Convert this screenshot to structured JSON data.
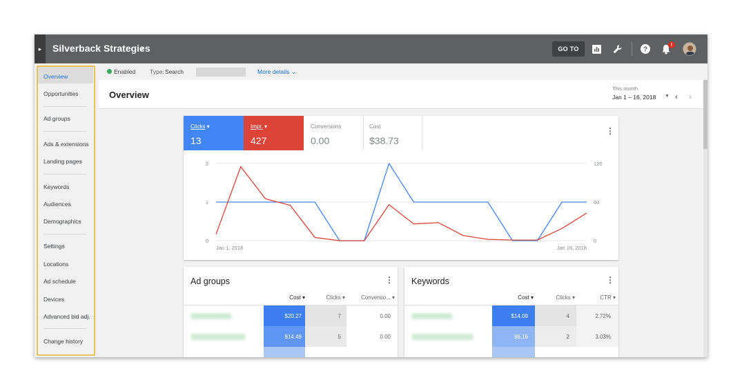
{
  "topbar": {
    "account_name": "Silverback Strategies",
    "chevron": "›",
    "drawer_icon": "▸",
    "goto_label": "GO TO",
    "icons": [
      "reports-icon",
      "tools-icon",
      "help-icon",
      "notifications-icon",
      "avatar"
    ],
    "notification_badge": "!"
  },
  "sidebar": {
    "items": [
      {
        "label": "Overview"
      },
      {
        "label": "Opportunities"
      },
      {
        "label": "Ad groups"
      },
      {
        "label": "Ads & extensions"
      },
      {
        "label": "Landing pages"
      },
      {
        "label": "Keywords"
      },
      {
        "label": "Audiences"
      },
      {
        "label": "Demographics"
      },
      {
        "label": "Settings"
      },
      {
        "label": "Locations"
      },
      {
        "label": "Ad schedule"
      },
      {
        "label": "Devices"
      },
      {
        "label": "Advanced bid adj."
      },
      {
        "label": "Change history"
      }
    ]
  },
  "status": {
    "state": "Enabled",
    "type_label": "Type:",
    "type_value": "Search",
    "more_details": "More details"
  },
  "header": {
    "title": "Overview",
    "range_label": "This month",
    "range_value": "Jan 1 – 16, 2018"
  },
  "metrics": [
    {
      "label": "Clicks",
      "value": "13",
      "color": "#4285f4",
      "active": true
    },
    {
      "label": "Impr.",
      "value": "427",
      "color": "#db4437",
      "active": true
    },
    {
      "label": "Conversions",
      "value": "0.00",
      "active": false
    },
    {
      "label": "Cost",
      "value": "$38.73",
      "active": false
    }
  ],
  "chart_data": {
    "type": "line",
    "x_start_label": "Jan 1, 2018",
    "x_end_label": "Jan 16, 2018",
    "left_axis_ticks": [
      "0",
      "1",
      "2"
    ],
    "right_axis_ticks": [
      "0",
      "60",
      "120"
    ],
    "ylim_left": [
      0,
      2
    ],
    "ylim_right": [
      0,
      120
    ],
    "series": [
      {
        "name": "Clicks",
        "axis": "left",
        "color": "#4285f4",
        "values": [
          1,
          1,
          1,
          1,
          1,
          0,
          0,
          2,
          1,
          1,
          1,
          1,
          0,
          0,
          1,
          1
        ]
      },
      {
        "name": "Impr.",
        "axis": "right",
        "color": "#db4437",
        "values": [
          10,
          115,
          65,
          55,
          5,
          0,
          0,
          56,
          26,
          28,
          8,
          2,
          1,
          1,
          19,
          43
        ]
      }
    ]
  },
  "ad_groups": {
    "title": "Ad groups",
    "columns": [
      "Cost",
      "Clicks",
      "Conversio..."
    ],
    "rows": [
      {
        "cost": "$20.27",
        "clicks": "7",
        "conversions": "0.00"
      },
      {
        "cost": "$14.49",
        "clicks": "5",
        "conversions": "0.00"
      }
    ]
  },
  "keywords": {
    "title": "Keywords",
    "columns": [
      "Cost",
      "Clicks",
      "CTR"
    ],
    "rows": [
      {
        "cost": "$14.09",
        "clicks": "4",
        "ctr": "2.72%"
      },
      {
        "cost": "$6.16",
        "clicks": "2",
        "ctr": "3.03%"
      }
    ]
  }
}
